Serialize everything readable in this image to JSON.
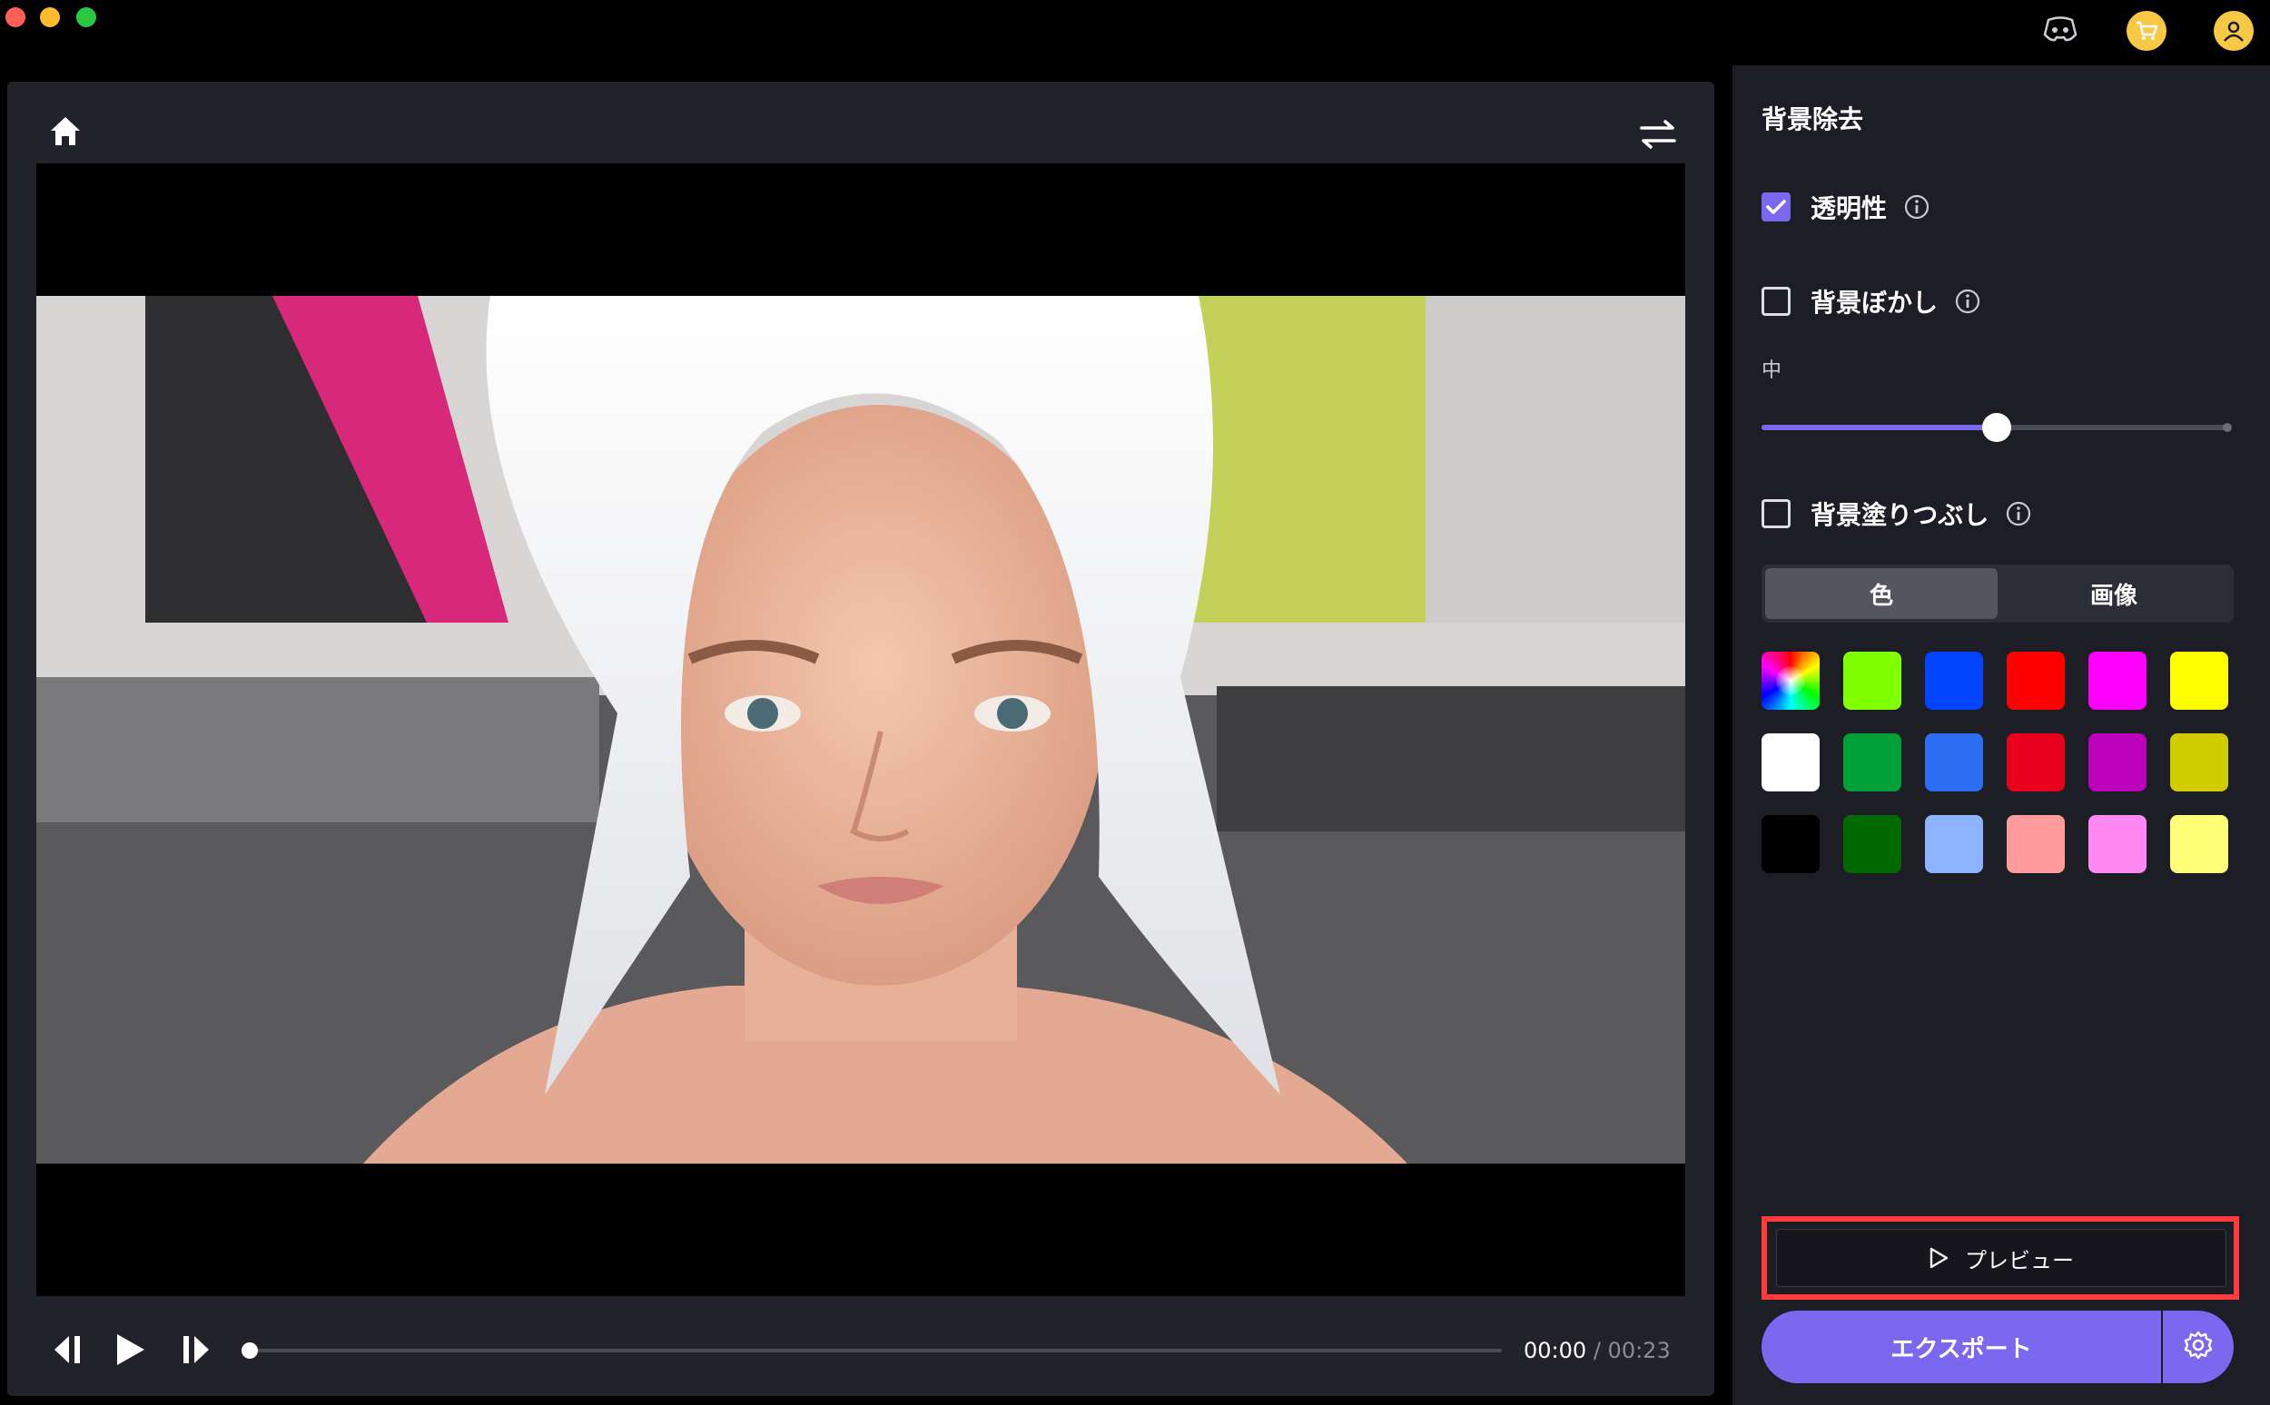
{
  "window": {
    "traffic_lights": [
      "close",
      "minimize",
      "zoom"
    ],
    "header_icons": [
      "discord-icon",
      "cart-icon",
      "user-icon"
    ]
  },
  "player": {
    "current_time": "00:00",
    "separator": "/",
    "duration": "00:23",
    "progress": 0,
    "icons": [
      "home-icon",
      "swap-icon",
      "step-back-icon",
      "play-icon",
      "step-forward-icon"
    ]
  },
  "sidebar": {
    "title": "背景除去",
    "options": {
      "transparency": {
        "label": "透明性",
        "checked": true
      },
      "blur": {
        "label": "背景ぼかし",
        "checked": false,
        "level_label": "中",
        "level": 0.5
      },
      "fill": {
        "label": "背景塗りつぶし",
        "checked": false
      }
    },
    "tabs": [
      {
        "label": "色",
        "active": true
      },
      {
        "label": "画像",
        "active": false
      }
    ],
    "swatches": [
      "picker",
      "#7fff00",
      "#0044ff",
      "#ff0000",
      "#ff00ff",
      "#ffff00",
      "#ffffff",
      "#00a03a",
      "#2c6ff2",
      "#e8001c",
      "#bb00bb",
      "#cfcc00",
      "#000000",
      "#006a00",
      "#8cb3ff",
      "#ff9b9b",
      "#ff88f5",
      "#ffff77"
    ],
    "preview_label": "プレビュー",
    "export_label": "エクスポート"
  },
  "colors": {
    "accent": "#7b68ee",
    "highlight_outline": "#ff3b3b",
    "panel": "#22222b",
    "sidebar": "#1d1d25"
  }
}
